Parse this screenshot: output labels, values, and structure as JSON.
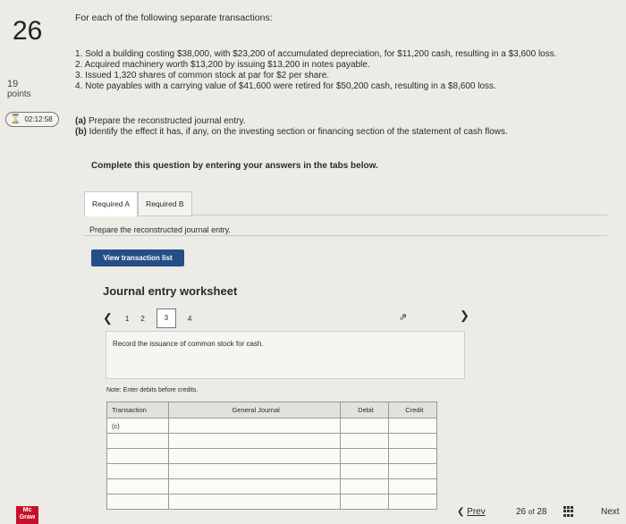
{
  "question": {
    "number": "26",
    "points_value": "19",
    "points_label": "points",
    "timer": "02:12:58"
  },
  "intro": "For each of the following separate transactions:",
  "transactions": [
    "1. Sold a building costing $38,000, with $23,200 of accumulated depreciation, for $11,200 cash, resulting in a $3,600 loss.",
    "2. Acquired machinery worth $13,200 by issuing $13,200 in notes payable.",
    "3. Issued 1,320 shares of common stock at par for $2 per share.",
    "4. Note payables with a carrying value of $41,600 were retired for $50,200 cash, resulting in a $8,600 loss."
  ],
  "parts": {
    "a_tag": "(a)",
    "a_text": "Prepare the reconstructed journal entry.",
    "b_tag": "(b)",
    "b_text": "Identify the effect it has, if any, on the investing section or financing section of the statement of cash flows."
  },
  "instruction": "Complete this question by entering your answers in the tabs below.",
  "tabs": [
    {
      "label": "Required A"
    },
    {
      "label": "Required B"
    }
  ],
  "prepare_text": "Prepare the reconstructed journal entry.",
  "view_button": "View transaction list",
  "worksheet": {
    "title": "Journal entry worksheet",
    "pages": [
      "1",
      "2",
      "3",
      "4"
    ],
    "current": "3",
    "record_text": "Record the issuance of common stock for cash.",
    "note": "Note: Enter debits before credits.",
    "headers": [
      "Transaction",
      "General Journal",
      "Debit",
      "Credit"
    ],
    "first_transaction": "(c)"
  },
  "nav": {
    "prev": "Prev",
    "page": "26",
    "of": "of",
    "total": "28",
    "next": "Next"
  },
  "logo": {
    "line1": "Mc",
    "line2": "Graw"
  },
  "colors": {
    "accent": "#244f86",
    "logo": "#c8102e"
  }
}
